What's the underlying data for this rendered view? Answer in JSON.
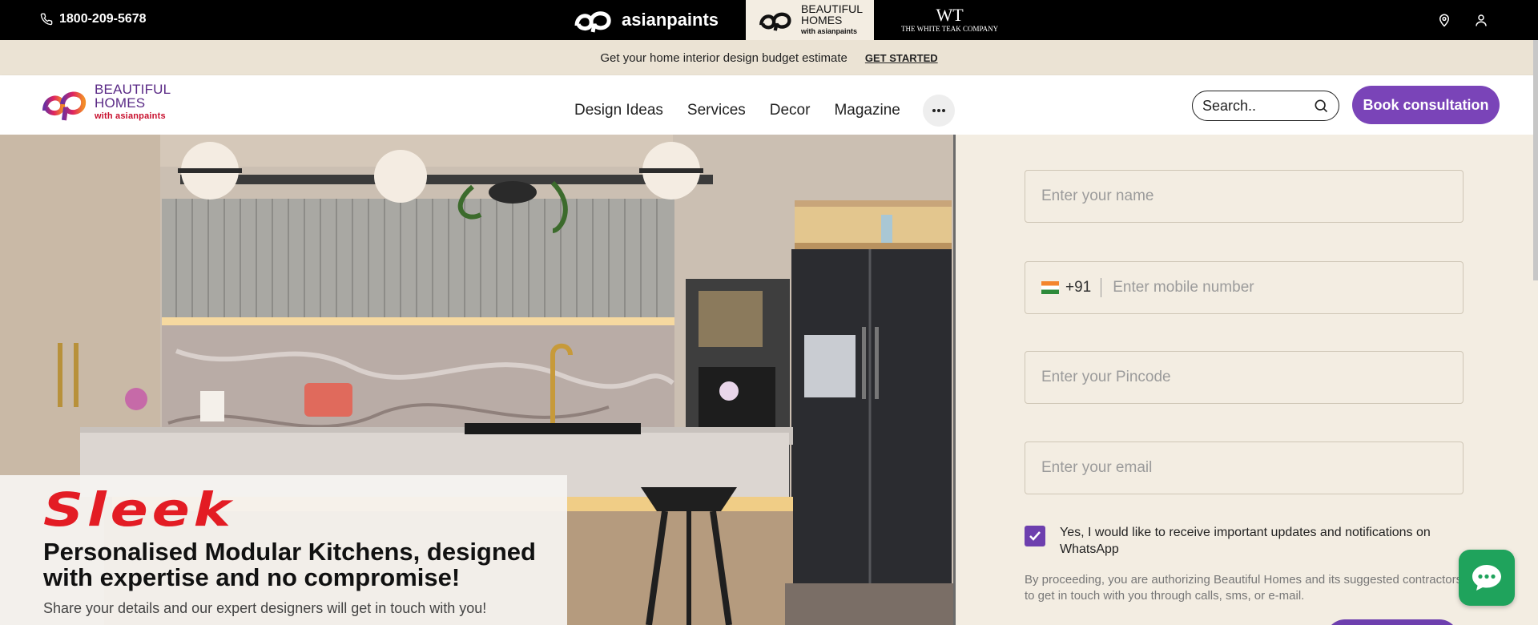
{
  "topbar": {
    "phone": "1800-209-5678",
    "brand_ap": "asianpaints",
    "brand_bh_line1": "BEAUTIFUL",
    "brand_bh_line2": "HOMES",
    "brand_bh_sub": "with asianpaints",
    "brand_wt_mono": "WT",
    "brand_wt_name": "THE WHITE TEAK COMPANY",
    "icons": [
      "location-pin-icon",
      "user-icon"
    ]
  },
  "announce": {
    "text": "Get your home interior design budget estimate",
    "cta": "GET STARTED"
  },
  "header": {
    "logo_line1": "BEAUTIFUL",
    "logo_line2": "HOMES",
    "logo_sub": "with asianpaints",
    "nav": [
      "Design Ideas",
      "Services",
      "Decor",
      "Magazine"
    ],
    "search_placeholder": "Search..",
    "book_label": "Book consultation"
  },
  "hero": {
    "brand": "Sleek",
    "headline_1": "Personalised Modular Kitchens, designed",
    "headline_2": "with expertise and no compromise!",
    "subtext": "Share your details and our expert designers will get in touch with you!"
  },
  "form": {
    "name_placeholder": "Enter your name",
    "country_code": "+91",
    "mobile_placeholder": "Enter mobile number",
    "pincode_placeholder": "Enter your Pincode",
    "email_placeholder": "Enter your email",
    "whatsapp_consent": "Yes, I would like to receive important updates and notifications on WhatsApp",
    "whatsapp_checked": true,
    "disclaimer": "By proceeding, you are authorizing Beautiful Homes and its suggested contractors to get in touch with you through calls, sms, or e-mail."
  },
  "colors": {
    "accent_purple": "#7a44b8",
    "brand_red": "#e31c24",
    "chat_green": "#1fa35c",
    "background_beige": "#f3ede2"
  }
}
